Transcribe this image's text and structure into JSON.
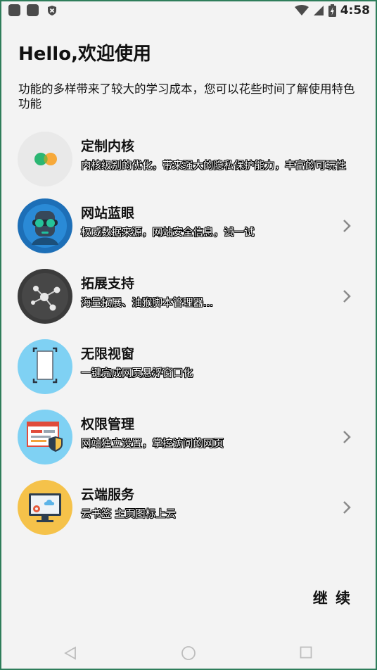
{
  "status_bar": {
    "time": "4:58"
  },
  "header": {
    "title": "Hello,欢迎使用",
    "subtitle": "功能的多样带来了较大的学习成本，您可以花些时间了解使用特色功能"
  },
  "features": [
    {
      "title": "定制内核",
      "desc": "内核级别的优化，带来强大的隐私保护能力，丰富的可玩性",
      "icon": "dots-icon",
      "chevron": false
    },
    {
      "title": "网站蓝眼",
      "desc": "权威数据来源，网站安全信息，试一试",
      "icon": "goggles-icon",
      "chevron": true
    },
    {
      "title": "拓展支持",
      "desc": "海量拓展、油猴脚本管理器...",
      "icon": "molecule-icon",
      "chevron": true
    },
    {
      "title": "无限视窗",
      "desc": "一键完成网页悬浮窗口化",
      "icon": "window-icon",
      "chevron": false
    },
    {
      "title": "权限管理",
      "desc": "网站独立设置，掌控访问的网页",
      "icon": "shield-browser-icon",
      "chevron": true
    },
    {
      "title": "云端服务",
      "desc": "云书签 主页图标上云",
      "icon": "cloud-monitor-icon",
      "chevron": true
    }
  ],
  "footer": {
    "continue_label": "继 续"
  },
  "colors": {
    "background": "#f3f3f3",
    "accent_green": "#2bb673",
    "accent_orange": "#f7a93a"
  }
}
